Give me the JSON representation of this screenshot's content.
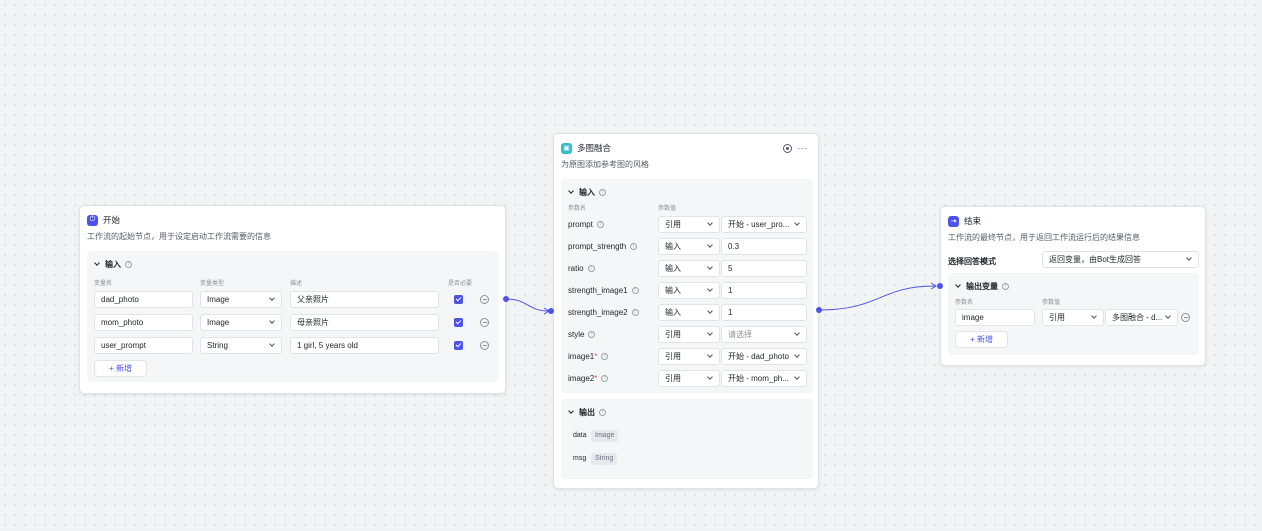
{
  "start": {
    "title": "开始",
    "desc": "工作流的起始节点，用于设定启动工作流需要的信息",
    "input_title": "输入",
    "col_name": "变量名",
    "col_type": "变量类型",
    "col_desc": "描述",
    "col_required": "是否必要",
    "rows": [
      {
        "name": "dad_photo",
        "type": "Image",
        "desc": "父亲照片"
      },
      {
        "name": "mom_photo",
        "type": "Image",
        "desc": "母亲照片"
      },
      {
        "name": "user_prompt",
        "type": "String",
        "desc": "1 girl, 5 years old"
      }
    ],
    "add_label": "新增"
  },
  "merge": {
    "title": "多图融合",
    "desc": "为原图添加参考图的风格",
    "input_title": "输入",
    "col_name": "参数名",
    "col_value": "参数值",
    "params": [
      {
        "label": "prompt",
        "required": "",
        "mode": "引用",
        "value": "开始 - user_pro..."
      },
      {
        "label": "prompt_strength",
        "required": "",
        "mode": "输入",
        "value": "0.3"
      },
      {
        "label": "ratio",
        "required": "",
        "mode": "输入",
        "value": "5"
      },
      {
        "label": "strength_image1",
        "required": "",
        "mode": "输入",
        "value": "1"
      },
      {
        "label": "strength_image2",
        "required": "",
        "mode": "输入",
        "value": "1"
      },
      {
        "label": "style",
        "required": "",
        "mode": "引用",
        "value": "请选择"
      },
      {
        "label": "image1",
        "required": "*",
        "mode": "引用",
        "value": "开始 - dad_photo"
      },
      {
        "label": "image2",
        "required": "*",
        "mode": "引用",
        "value": "开始 - mom_ph..."
      }
    ],
    "output_title": "输出",
    "outputs": [
      {
        "name": "data",
        "type": "Image"
      },
      {
        "name": "msg",
        "type": "String"
      }
    ]
  },
  "end": {
    "title": "结束",
    "desc": "工作流的最终节点，用于返回工作流运行后的结果信息",
    "mode_label": "选择回答模式",
    "mode_value": "返回变量，由Bot生成回答",
    "output_title": "输出变量",
    "col_name": "参数名",
    "col_value": "参数值",
    "row": {
      "name": "image",
      "mode": "引用",
      "value": "多图融合 - d..."
    },
    "add_label": "新增"
  },
  "colors": {
    "accent": "#4d53e8",
    "start_icon": "#4d53e8",
    "merge_icon": "#2fbbd0",
    "end_icon": "#4d53e8"
  }
}
